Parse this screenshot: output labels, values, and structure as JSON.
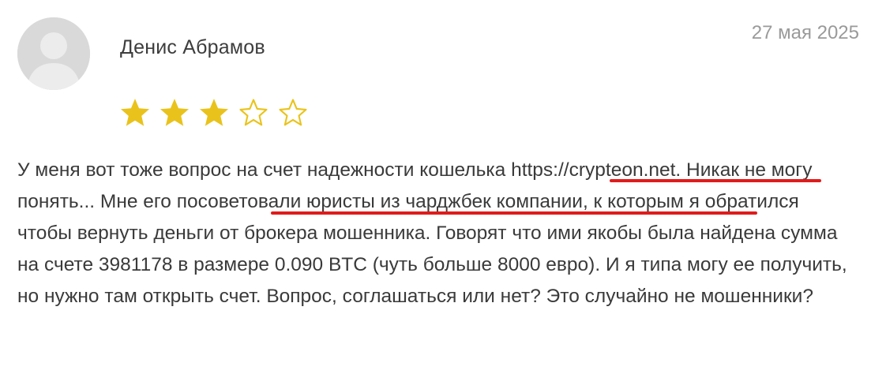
{
  "review": {
    "author": "Денис Абрамов",
    "date": "27 мая 2025",
    "rating": 3,
    "rating_max": 5,
    "text_before_link": "У меня вот тоже вопрос на счет надежности кошелька ",
    "link": "https://crypteon.net.",
    "text_after_link": " Никак не могу понять... ",
    "highlight": "Мне его посоветовали юристы из чарджбек",
    "text_end": " компании, к которым я обратился чтобы вернуть деньги от брокера мошенника. Говорят что ими якобы была найдена сумма на счете 3981178 в размере 0.090 BTC (чуть больше 8000 евро). И я типа могу ее получить, но нужно там открыть счет. Вопрос, соглашаться или нет? Это случайно не мошенники?"
  },
  "colors": {
    "star_filled": "#e9c31b",
    "underline": "#e01b1b",
    "avatar_bg": "#d9d9d9"
  },
  "icons": {
    "avatar": "user-avatar-icon",
    "star_filled": "star-filled-icon",
    "star_empty": "star-empty-icon"
  }
}
